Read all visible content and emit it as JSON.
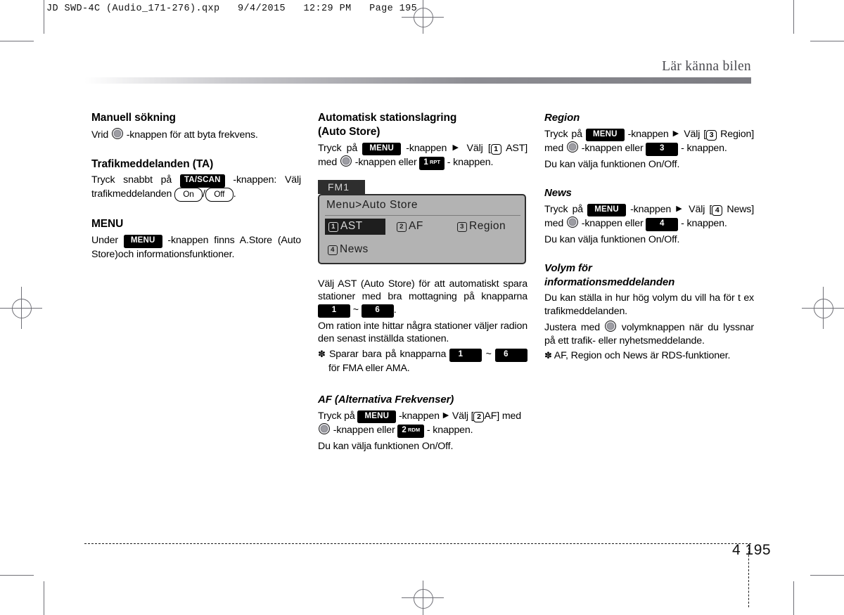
{
  "file_info": "JD SWD-4C (Audio_171-276).qxp   9/4/2015   12:29 PM   Page 195",
  "header": {
    "chapter_title": "Lär känna bilen"
  },
  "footer": {
    "chapter_number": "4",
    "page_number": "195"
  },
  "columns": {
    "left": {
      "manual_search": {
        "heading": "Manuell sökning",
        "line_pre": "Vrid",
        "line_post": "-knappen för att byta frekvens.",
        "knob_icon": "rotary-knob-icon"
      },
      "traffic": {
        "heading": "Trafikmeddelanden (TA)",
        "line_pre": "Tryck snabbt på",
        "button": "TA/SCAN",
        "line_mid": "-knappen: Välj trafikmeddelanden",
        "pill_on": "On",
        "pill_off": "Off",
        "line_end": "."
      },
      "menu": {
        "heading": "MENU",
        "line_pre": "Under",
        "button": "MENU",
        "line_post": "-knappen finns A.Store (Auto Store)och informationsfunktioner."
      }
    },
    "middle": {
      "auto_store": {
        "heading_line1": "Automatisk stationslagring",
        "heading_line2": "(Auto Store)",
        "t1": "Tryck på",
        "btn_menu": "MENU",
        "t2": "-knappen",
        "arrow": "▶",
        "t3": "Välj [",
        "num1": "1",
        "t4": "AST] med",
        "t5": "-knappen eller",
        "btn_1rpt_num": "1",
        "btn_1rpt_sub": "RPT",
        "t6": "- knappen."
      },
      "lcd": {
        "tab_label": "FM1",
        "path": "Menu>Auto Store",
        "items": [
          {
            "num": "1",
            "label": "AST",
            "selected": true
          },
          {
            "num": "2",
            "label": "AF",
            "selected": false
          },
          {
            "num": "3",
            "label": "Region",
            "selected": false
          },
          {
            "num": "4",
            "label": "News",
            "selected": false
          }
        ]
      },
      "ast_desc": {
        "p1_a": "Välj AST (Auto Store) för att automatiskt spara stationer med bra mottagning på knapparna",
        "btn_1": "1",
        "tilde": "~",
        "btn_6": "6",
        "p1_end": ".",
        "p2": "Om ration inte hittar några stationer väljer radion den senast inställda stationen.",
        "note_ast": "✽",
        "note_a": "Sparar bara på knapparna",
        "note_btn_1": "1",
        "note_tilde": "~",
        "note_btn_6": "6",
        "note_b": "för FMA eller AMA."
      },
      "af": {
        "heading": "AF (Alternativa Frekvenser)",
        "t1": "Tryck på",
        "btn_menu": "MENU",
        "t2": "-knappen",
        "arrow": "▶",
        "t3": "Välj [",
        "num2": "2",
        "t4": "AF] med",
        "t5": "-knappen eller",
        "btn_2rdm_num": "2",
        "btn_2rdm_sub": "RDM",
        "t6": "- knappen.",
        "t7": "Du kan välja funktionen On/Off."
      }
    },
    "right": {
      "region": {
        "heading": "Region",
        "t1": "Tryck på",
        "btn_menu": "MENU",
        "t2": "-knappen",
        "arrow": "▶",
        "t3": "Välj [",
        "num3": "3",
        "t4": "Region] med",
        "t5": "-knappen eller",
        "btn_3": "3",
        "t6": "- knappen.",
        "t7": "Du kan välja funktionen On/Off."
      },
      "news": {
        "heading": "News",
        "t1": "Tryck på",
        "btn_menu": "MENU",
        "t2": "-knappen",
        "arrow": "▶",
        "t3": "Välj [",
        "num4": "4",
        "t4": "News] med",
        "t5": "-knappen eller",
        "btn_4": "4",
        "t6": "- knappen.",
        "t7": "Du kan välja funktionen On/Off."
      },
      "volume": {
        "heading_line1": "Volym för",
        "heading_line2": "informationsmeddelanden",
        "p1": "Du kan ställa in hur hög volym du vill ha för t ex trafikmeddelanden.",
        "p2_a": "Justera med",
        "p2_b": "volymknappen när du lyssnar på ett trafik- eller nyhetsmeddelande.",
        "note_ast": "✽",
        "note": "AF, Region och News är RDS-funktioner."
      }
    }
  }
}
